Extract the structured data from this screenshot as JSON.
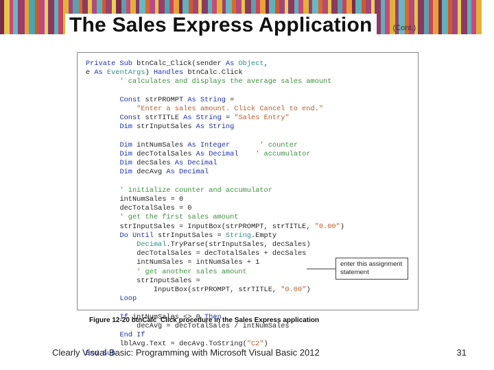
{
  "header": {
    "title": "The Sales Express Application",
    "cont": "(Cont.)"
  },
  "code": {
    "l1a": "Private Sub",
    "l1b": " btnCalc_Click(sender ",
    "l1c": "As",
    "l1d": " ",
    "l1e": "Object",
    "l1f": ",",
    "l2a": "e ",
    "l2b": "As",
    "l2c": " ",
    "l2d": "EventArgs",
    "l2e": ") ",
    "l2f": "Handles",
    "l2g": " btnCalc.Click",
    "l3": "' calculates and displays the average sales amount",
    "l5a": "Const",
    "l5b": " strPROMPT ",
    "l5c": "As String",
    "l5d": " =",
    "l6": "\"Enter a sales amount. Click Cancel to end.\"",
    "l7a": "Const",
    "l7b": " strTITLE ",
    "l7c": "As String",
    "l7d": " = ",
    "l7e": "\"Sales Entry\"",
    "l8a": "Dim",
    "l8b": " strInputSales ",
    "l8c": "As String",
    "l10a": "Dim",
    "l10b": " intNumSales ",
    "l10c": "As Integer",
    "l10d": "' counter",
    "l11a": "Dim",
    "l11b": " decTotalSales ",
    "l11c": "As Decimal",
    "l11d": "' accumulator",
    "l12a": "Dim",
    "l12b": " decSales ",
    "l12c": "As Decimal",
    "l13a": "Dim",
    "l13b": " decAvg ",
    "l13c": "As Decimal",
    "l15": "' initialize counter and accumulator",
    "l16": "intNumSales = 0",
    "l17": "decTotalSales = 0",
    "l18": "' get the first sales amount",
    "l19a": "strInputSales = InputBox(strPROMPT, strTITLE, ",
    "l19b": "\"0.00\"",
    "l19c": ")",
    "l20a": "Do Until",
    "l20b": " strInputSales = ",
    "l20c": "String",
    "l20d": ".Empty",
    "l21a": "Decimal",
    "l21b": ".TryParse(strInputSales, decSales)",
    "l22": "decTotalSales = decTotalSales + decSales",
    "l23": "intNumSales = intNumSales + 1",
    "l24": "' get another sales amount",
    "l25": "strInputSales =",
    "l26a": "InputBox(strPROMPT, strTITLE, ",
    "l26b": "\"0.00\"",
    "l26c": ")",
    "l27": "Loop",
    "l29a": "If",
    "l29b": " intNumSales <> 0 ",
    "l29c": "Then",
    "l30": "decAvg = decTotalSales / intNumSales",
    "l31": "End If",
    "l32a": "lblAvg.Text = decAvg.ToString(",
    "l32b": "\"C2\"",
    "l32c": ")",
    "l33": "End Sub"
  },
  "callout": "enter this assignment statement",
  "figure_caption": "Figure 12-20 btnCalc_Click procedure in the Sales Express application",
  "footer": {
    "book": "Clearly Visual Basic: Programming with Microsoft Visual Basic 2012",
    "page": "31"
  },
  "banner_colors": [
    {
      "c": "#7d2a4a",
      "w": 6
    },
    {
      "c": "#e4c64b",
      "w": 8
    },
    {
      "c": "#c84a7a",
      "w": 5
    },
    {
      "c": "#6ab7c4",
      "w": 7
    },
    {
      "c": "#9a3d6a",
      "w": 10
    },
    {
      "c": "#e6a23a",
      "w": 6
    },
    {
      "c": "#4aa6b0",
      "w": 9
    },
    {
      "c": "#d05a2a",
      "w": 6
    },
    {
      "c": "#b74a8a",
      "w": 8
    },
    {
      "c": "#e7cf5a",
      "w": 5
    },
    {
      "c": "#8a3a5d",
      "w": 9
    },
    {
      "c": "#5fb2bd",
      "w": 6
    },
    {
      "c": "#c9455f",
      "w": 7
    },
    {
      "c": "#e0b23a",
      "w": 8
    },
    {
      "c": "#a2467a",
      "w": 6
    },
    {
      "c": "#5aa0ad",
      "w": 9
    },
    {
      "c": "#d86a2a",
      "w": 5
    },
    {
      "c": "#8d3a63",
      "w": 8
    },
    {
      "c": "#e4c64b",
      "w": 6
    },
    {
      "c": "#b24a7d",
      "w": 7
    },
    {
      "c": "#60b0bb",
      "w": 8
    },
    {
      "c": "#d05a2a",
      "w": 5
    },
    {
      "c": "#9c4070",
      "w": 9
    },
    {
      "c": "#e7cf5a",
      "w": 6
    },
    {
      "c": "#7d2a4a",
      "w": 8
    },
    {
      "c": "#5aa0ad",
      "w": 7
    },
    {
      "c": "#c84a7a",
      "w": 6
    },
    {
      "c": "#e0b23a",
      "w": 8
    },
    {
      "c": "#8a3a5d",
      "w": 5
    },
    {
      "c": "#6ab7c4",
      "w": 9
    },
    {
      "c": "#d86a2a",
      "w": 6
    },
    {
      "c": "#b74a8a",
      "w": 8
    },
    {
      "c": "#e4c64b",
      "w": 5
    },
    {
      "c": "#9a3d6a",
      "w": 9
    },
    {
      "c": "#4aa6b0",
      "w": 7
    },
    {
      "c": "#c9455f",
      "w": 6
    },
    {
      "c": "#e6a23a",
      "w": 8
    },
    {
      "c": "#7d2a4a",
      "w": 5
    },
    {
      "c": "#5fb2bd",
      "w": 9
    },
    {
      "c": "#d05a2a",
      "w": 6
    },
    {
      "c": "#a2467a",
      "w": 8
    },
    {
      "c": "#e7cf5a",
      "w": 5
    },
    {
      "c": "#8d3a63",
      "w": 9
    },
    {
      "c": "#60b0bb",
      "w": 6
    },
    {
      "c": "#c84a7a",
      "w": 7
    },
    {
      "c": "#e0b23a",
      "w": 8
    },
    {
      "c": "#9c4070",
      "w": 5
    },
    {
      "c": "#6ab7c4",
      "w": 9
    },
    {
      "c": "#d86a2a",
      "w": 6
    },
    {
      "c": "#b24a7d",
      "w": 8
    },
    {
      "c": "#e4c64b",
      "w": 5
    },
    {
      "c": "#8a3a5d",
      "w": 9
    },
    {
      "c": "#5aa0ad",
      "w": 7
    },
    {
      "c": "#c9455f",
      "w": 6
    },
    {
      "c": "#e6a23a",
      "w": 8
    },
    {
      "c": "#7d2a4a",
      "w": 5
    },
    {
      "c": "#5fb2bd",
      "w": 9
    },
    {
      "c": "#d05a2a",
      "w": 6
    },
    {
      "c": "#a2467a",
      "w": 8
    },
    {
      "c": "#e7cf5a",
      "w": 5
    },
    {
      "c": "#8d3a63",
      "w": 9
    },
    {
      "c": "#60b0bb",
      "w": 6
    },
    {
      "c": "#c84a7a",
      "w": 7
    },
    {
      "c": "#e0b23a",
      "w": 8
    },
    {
      "c": "#9c4070",
      "w": 5
    },
    {
      "c": "#6ab7c4",
      "w": 9
    },
    {
      "c": "#d86a2a",
      "w": 6
    },
    {
      "c": "#b24a7d",
      "w": 8
    },
    {
      "c": "#e4c64b",
      "w": 5
    },
    {
      "c": "#8a3a5d",
      "w": 9
    },
    {
      "c": "#5aa0ad",
      "w": 7
    },
    {
      "c": "#c9455f",
      "w": 6
    },
    {
      "c": "#e6a23a",
      "w": 8
    },
    {
      "c": "#7d2a4a",
      "w": 5
    },
    {
      "c": "#5fb2bd",
      "w": 9
    },
    {
      "c": "#d05a2a",
      "w": 6
    },
    {
      "c": "#a2467a",
      "w": 8
    },
    {
      "c": "#e7cf5a",
      "w": 5
    },
    {
      "c": "#8d3a63",
      "w": 9
    },
    {
      "c": "#60b0bb",
      "w": 6
    },
    {
      "c": "#c84a7a",
      "w": 7
    },
    {
      "c": "#e0b23a",
      "w": 8
    },
    {
      "c": "#9c4070",
      "w": 5
    },
    {
      "c": "#6ab7c4",
      "w": 9
    },
    {
      "c": "#d86a2a",
      "w": 6
    },
    {
      "c": "#b24a7d",
      "w": 8
    },
    {
      "c": "#e4c64b",
      "w": 5
    },
    {
      "c": "#8a3a5d",
      "w": 9
    },
    {
      "c": "#5aa0ad",
      "w": 7
    },
    {
      "c": "#c9455f",
      "w": 6
    },
    {
      "c": "#e6a23a",
      "w": 8
    },
    {
      "c": "#7d2a4a",
      "w": 5
    },
    {
      "c": "#5fb2bd",
      "w": 9
    },
    {
      "c": "#d05a2a",
      "w": 6
    },
    {
      "c": "#a2467a",
      "w": 8
    },
    {
      "c": "#e7cf5a",
      "w": 5
    },
    {
      "c": "#8d3a63",
      "w": 9
    },
    {
      "c": "#60b0bb",
      "w": 6
    },
    {
      "c": "#c84a7a",
      "w": 7
    },
    {
      "c": "#e0b23a",
      "w": 8
    }
  ]
}
